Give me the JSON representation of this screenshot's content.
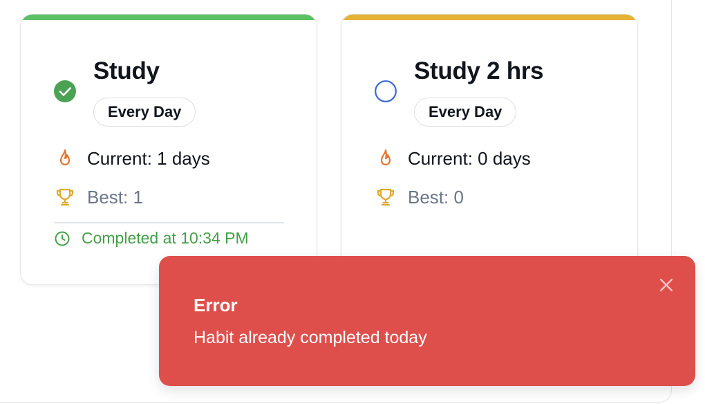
{
  "colors": {
    "done_bar": "#5cc065",
    "pending_bar": "#e3b236",
    "done_check": "#4ba254",
    "pending_circle": "#3b67d9",
    "flame": "#e8742c",
    "trophy": "#e0a82a",
    "completed_text": "#43a047",
    "toast_bg": "#de4f4b"
  },
  "habits": [
    {
      "title": "Study",
      "frequency": "Every Day",
      "current": "Current: 1 days",
      "best": "Best: 1",
      "completed": "Completed at 10:34 PM",
      "done": true
    },
    {
      "title": "Study 2 hrs",
      "frequency": "Every Day",
      "current": "Current: 0 days",
      "best": "Best: 0",
      "done": false
    }
  ],
  "toast": {
    "title": "Error",
    "message": "Habit already completed today",
    "close_icon": "close-icon"
  },
  "icons": {
    "status_done": "check-circle-icon",
    "status_pending": "empty-circle-icon",
    "streak": "flame-icon",
    "best": "trophy-icon",
    "completed": "clock-icon"
  }
}
